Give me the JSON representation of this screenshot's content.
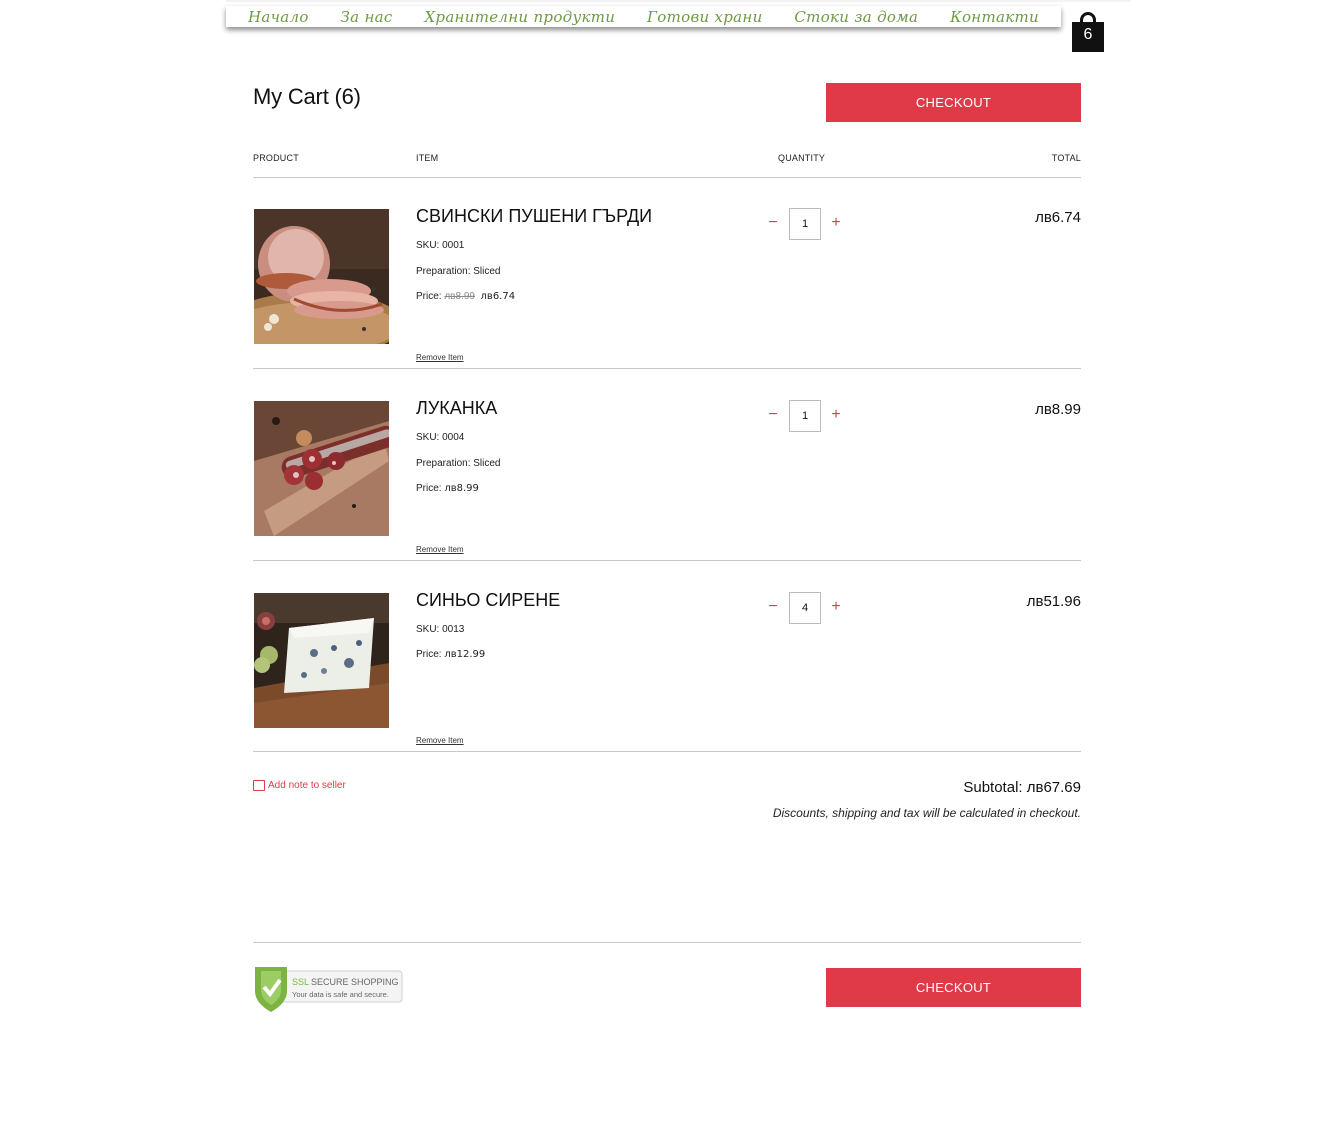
{
  "nav": {
    "items": [
      "Начало",
      "За нас",
      "Хранителни продукти",
      "Готови храни",
      "Стоки за дома",
      "Контакти"
    ]
  },
  "cart_badge": {
    "count": "6",
    "icon": "shopping-bag-icon"
  },
  "page": {
    "title": "My Cart (6)",
    "checkout_label": "CHECKOUT"
  },
  "columns": {
    "product": "PRODUCT",
    "item": "ITEM",
    "quantity": "QUANTITY",
    "total": "TOTAL"
  },
  "items": [
    {
      "name": "СВИНСКИ ПУШЕНИ ГЪРДИ",
      "sku": "SKU: 0001",
      "preparation": "Preparation: Sliced",
      "price_label": "Price: ",
      "price_old": "лв8.99",
      "price": "лв6.74",
      "quantity": "1",
      "total": "лв6.74",
      "remove_label": "Remove Item"
    },
    {
      "name": "ЛУКАНКА",
      "sku": "SKU: 0004",
      "preparation": "Preparation: Sliced",
      "price_label": "Price: ",
      "price": "лв8.99",
      "quantity": "1",
      "total": "лв8.99",
      "remove_label": "Remove Item"
    },
    {
      "name": "СИНЬО СИРЕНЕ",
      "sku": "SKU: 0013",
      "price_label": "Price: ",
      "price": "лв12.99",
      "quantity": "4",
      "total": "лв51.96",
      "remove_label": "Remove Item"
    }
  ],
  "qty_minus": "−",
  "qty_plus": "+",
  "footer": {
    "note_label": "Add note to seller",
    "subtotal": "Subtotal: лв67.69",
    "tax_note": "Discounts, shipping and tax will be calculated in checkout.",
    "ssl_title": "SECURE SHOPPING",
    "ssl_prefix": "SSL",
    "ssl_sub": "Your data is safe and secure."
  },
  "colors": {
    "accent": "#e03a48",
    "nav_text": "#6f9a45"
  }
}
